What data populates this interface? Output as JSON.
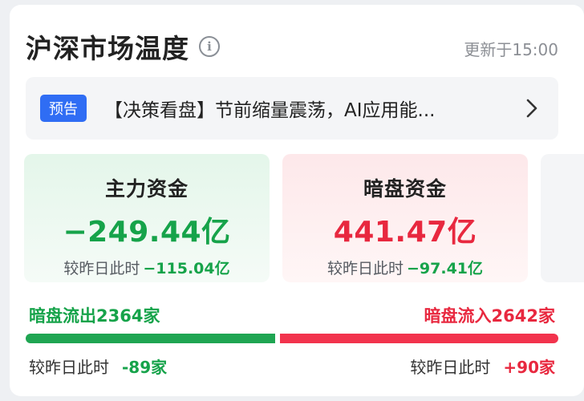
{
  "header": {
    "title": "沪深市场温度",
    "info_icon": "info-icon",
    "update_time": "更新于15:00"
  },
  "notice": {
    "tag": "预告",
    "text": "【决策看盘】节前缩量震荡，AI应用能...",
    "chevron_icon": "chevron-right-icon"
  },
  "panels": {
    "main_funds": {
      "title": "主力资金",
      "value": "−249.44亿",
      "compare_label": "较昨日此时",
      "compare_delta": "−115.04亿"
    },
    "dark_funds": {
      "title": "暗盘资金",
      "value": "441.47亿",
      "compare_label": "较昨日此时",
      "compare_delta": "−97.41亿"
    }
  },
  "flow": {
    "outflow_label": "暗盘流出2364家",
    "inflow_label": "暗盘流入2642家",
    "outflow_count": 2364,
    "inflow_count": 2642,
    "out_compare_label": "较昨日此时",
    "out_compare_delta": "-89家",
    "in_compare_label": "较昨日此时",
    "in_compare_delta": "+90家"
  },
  "colors": {
    "up_red": "#e8283f",
    "down_green": "#16a34a",
    "tag_blue": "#2f6df4"
  }
}
